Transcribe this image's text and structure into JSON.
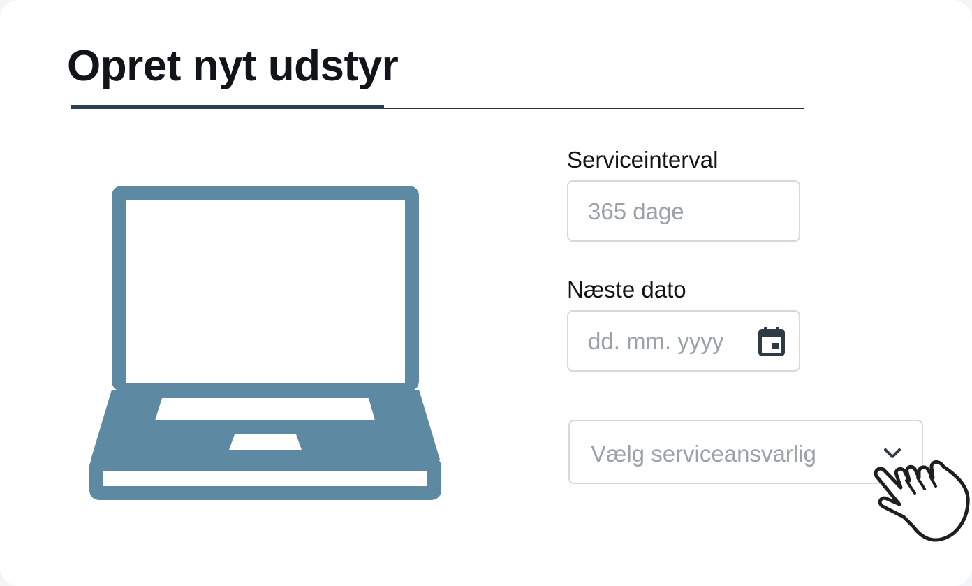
{
  "page": {
    "title": "Opret nyt udstyr"
  },
  "illustration": {
    "icon": "laptop-icon",
    "color": "#5d89a3"
  },
  "form": {
    "service_interval": {
      "label": "Serviceinterval",
      "placeholder": "365 dage"
    },
    "next_date": {
      "label": "Næste dato",
      "placeholder": "dd. mm. yyyy",
      "icon": "calendar-icon"
    },
    "service_owner": {
      "placeholder": "Vælg serviceansvarlig",
      "icon": "chevron-down-icon"
    }
  },
  "cursor": {
    "icon": "pointing-hand-icon"
  },
  "colors": {
    "title_text": "#111418",
    "accent_rule": "#2e4050",
    "field_border": "#d6d9dc",
    "placeholder_text": "#9aa1a8"
  }
}
